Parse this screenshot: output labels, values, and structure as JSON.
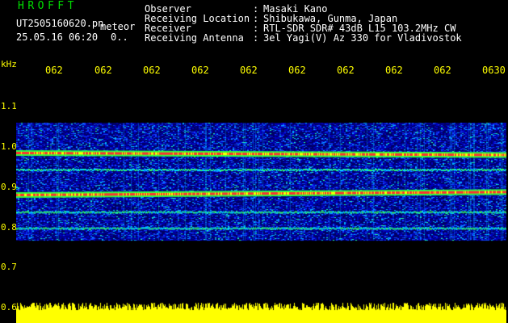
{
  "header": {
    "app_title": "HROFFT",
    "file_name": "UT2505160620.pn",
    "meteor_label": "meteor",
    "date_time": "25.05.16 06:20",
    "zero_dot": "0.."
  },
  "info": [
    {
      "key": "Observer",
      "sep": ":",
      "value": "Masaki Kano"
    },
    {
      "key": "Receiving Location",
      "sep": ":",
      "value": "Shibukawa, Gunma, Japan"
    },
    {
      "key": "Receiver",
      "sep": ":",
      "value": "RTL-SDR SDR# 43dB L15 103.2MHz CW"
    },
    {
      "key": "Receiving Antenna",
      "sep": ":",
      "value": "3el Yagi(V) Az 330 for Vladivostok"
    }
  ],
  "axes": {
    "y_unit": "kHz",
    "y_ticks": [
      "1.1",
      "1.0",
      "0.9",
      "0.8",
      "0.7",
      "0.6"
    ],
    "x_ticks": [
      "062",
      "062",
      "062",
      "062",
      "062",
      "062",
      "062",
      "062",
      "062",
      "0630"
    ]
  },
  "spectrogram": {
    "y_range_khz": [
      0.6,
      1.15
    ],
    "signal_region_khz": [
      0.745,
      1.035
    ],
    "strong_lines_khz": [
      0.962,
      0.858
    ],
    "weak_lines_khz": [
      0.92,
      0.815,
      0.775
    ],
    "noise_floor_color": "#0000aa",
    "line_color": "#ff2020",
    "power_bar_color": "#ffff00"
  }
}
